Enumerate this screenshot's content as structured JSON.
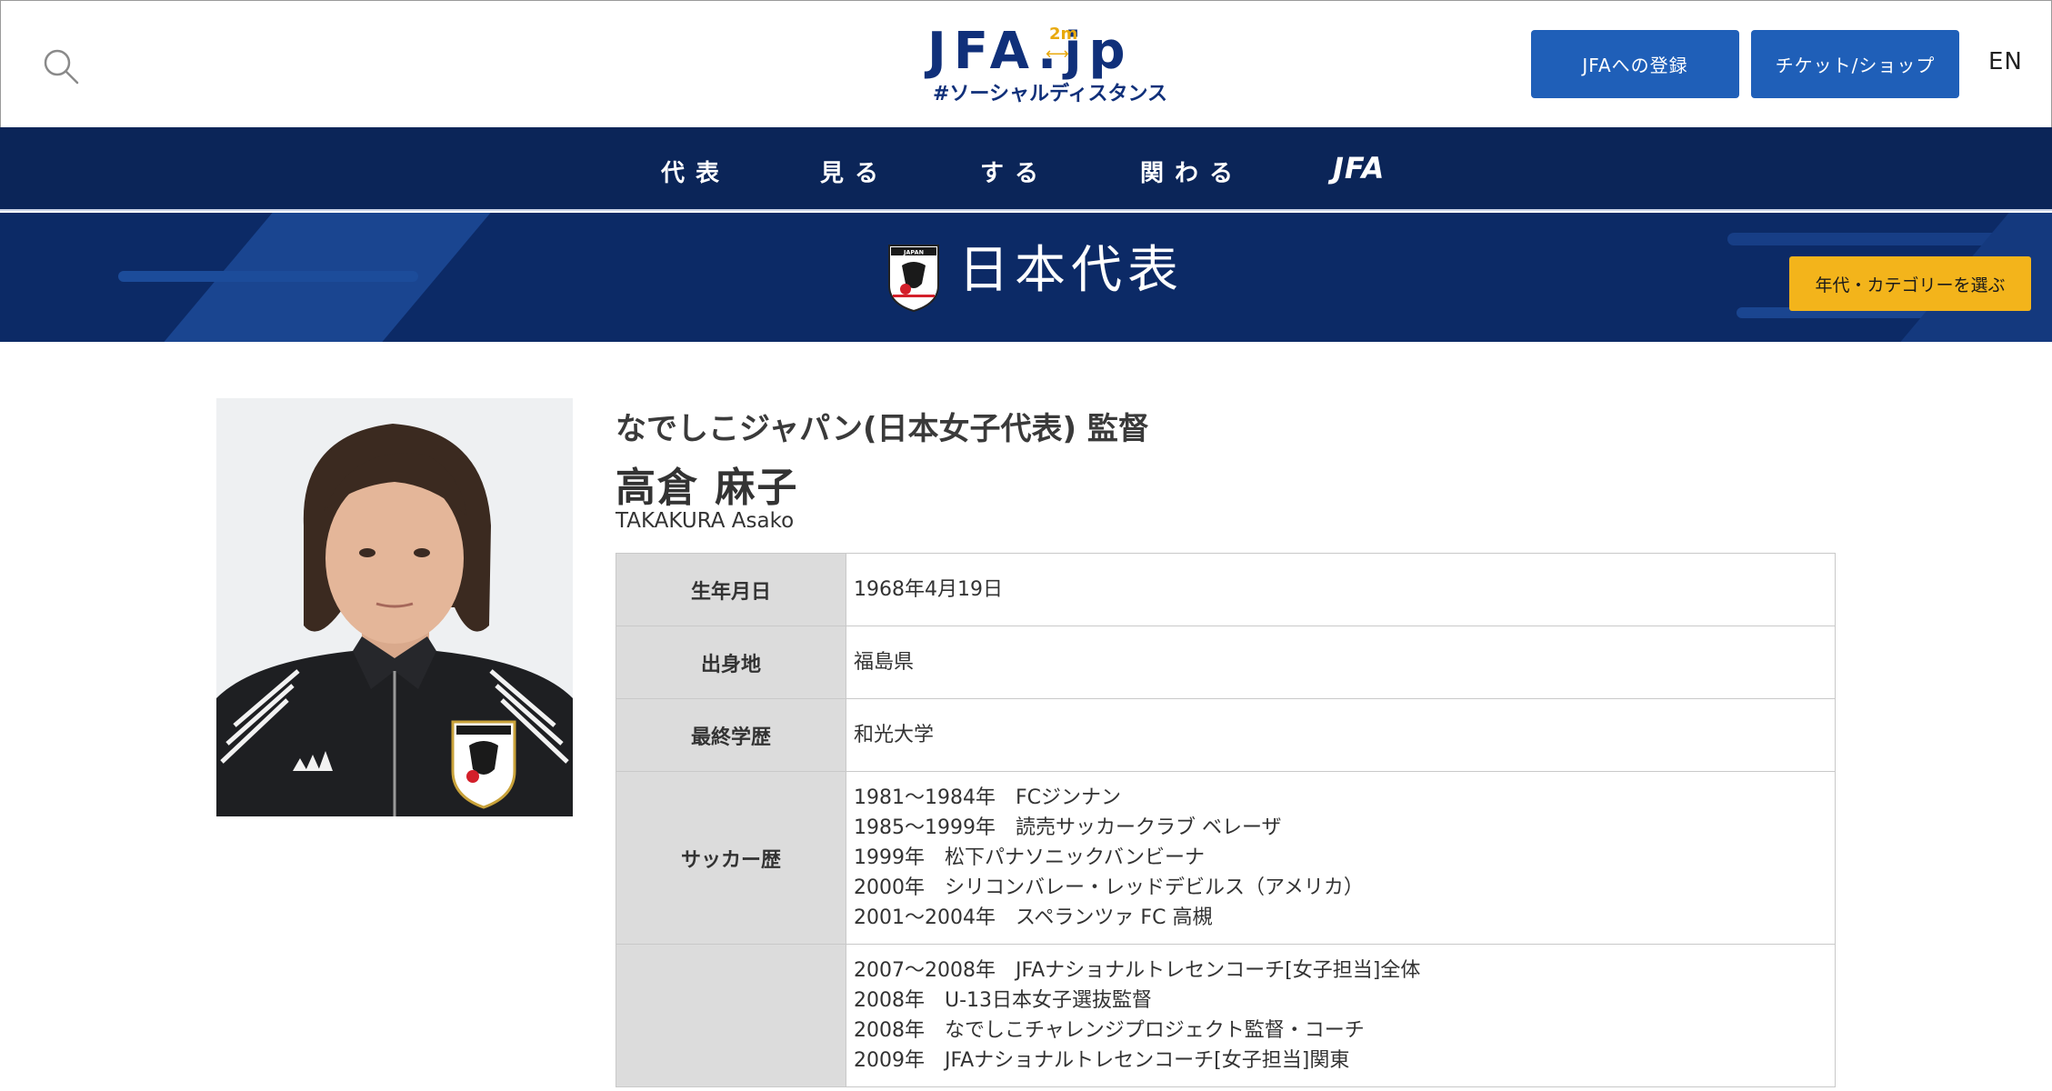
{
  "header": {
    "logo_text": "JFA.jp",
    "logo_badge": "2m",
    "logo_subtitle": "#ソーシャルディスタンス",
    "register_button": "JFAへの登録",
    "shop_button": "チケット/ショップ",
    "lang_toggle": "EN"
  },
  "nav": {
    "items": [
      {
        "label": "代表"
      },
      {
        "label": "見る"
      },
      {
        "label": "する"
      },
      {
        "label": "関わる"
      },
      {
        "label": "JFA"
      }
    ]
  },
  "banner": {
    "title": "日本代表",
    "category_button": "年代・カテゴリーを選ぶ"
  },
  "profile": {
    "role": "なでしこジャパン(日本女子代表) 監督",
    "name_ja": "高倉 麻子",
    "name_en": "TAKAKURA Asako",
    "rows": [
      {
        "label": "生年月日",
        "lines": [
          "1968年4月19日"
        ]
      },
      {
        "label": "出身地",
        "lines": [
          "福島県"
        ]
      },
      {
        "label": "最終学歴",
        "lines": [
          "和光大学"
        ]
      },
      {
        "label": "サッカー歴",
        "lines": [
          "1981〜1984年　FCジンナン",
          "1985〜1999年　読売サッカークラブ ベレーザ",
          "1999年　松下パナソニックバンビーナ",
          "2000年　シリコンバレー・レッドデビルス（アメリカ）",
          "2001〜2004年　スペランツァ FC 高槻"
        ]
      },
      {
        "label": "",
        "lines": [
          "2007〜2008年　JFAナショナルトレセンコーチ[女子担当]全体",
          "2008年　U-13日本女子選抜監督",
          "2008年　なでしこチャレンジプロジェクト監督・コーチ",
          "2009年　JFAナショナルトレセンコーチ[女子担当]関東"
        ]
      }
    ]
  },
  "photo_badge_text": "JAPAN",
  "colors": {
    "nav_bg": "#0b2558",
    "banner_bg": "#0c2a66",
    "button_blue": "#1f5fb8",
    "button_yellow": "#f3b41b"
  }
}
